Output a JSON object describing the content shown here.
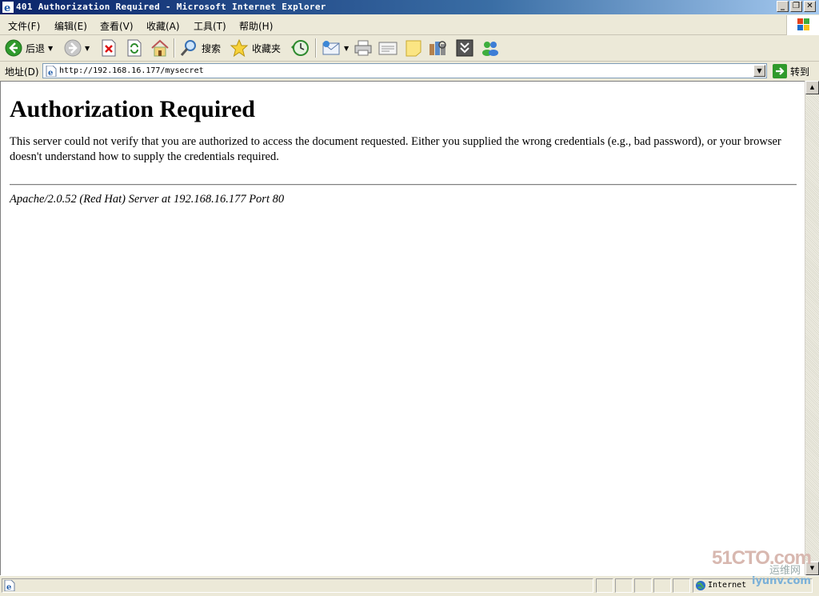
{
  "window": {
    "title": "401 Authorization Required - Microsoft Internet Explorer",
    "minimize": "_",
    "restore": "❐",
    "close": "✕"
  },
  "menubar": {
    "items": [
      "文件(F)",
      "编辑(E)",
      "查看(V)",
      "收藏(A)",
      "工具(T)",
      "帮助(H)"
    ]
  },
  "toolbar": {
    "back_label": "后退",
    "search_label": "搜索",
    "favorites_label": "收藏夹"
  },
  "address": {
    "label": "地址(D)",
    "url": "http://192.168.16.177/mysecret",
    "go_label": "转到"
  },
  "page": {
    "heading": "Authorization Required",
    "paragraph": "This server could not verify that you are authorized to access the document requested. Either you supplied the wrong credentials (e.g., bad password), or your browser doesn't understand how to supply the credentials required.",
    "server_signature": "Apache/2.0.52 (Red Hat) Server at 192.168.16.177 Port 80"
  },
  "statusbar": {
    "zone": "Internet"
  },
  "watermark": {
    "site": "51CTO.com",
    "cn": "运维网",
    "sub": "iyunv.com"
  },
  "colors": {
    "titlebar": "#0a246a",
    "chrome": "#ece9d8",
    "link": "#0a246a"
  }
}
